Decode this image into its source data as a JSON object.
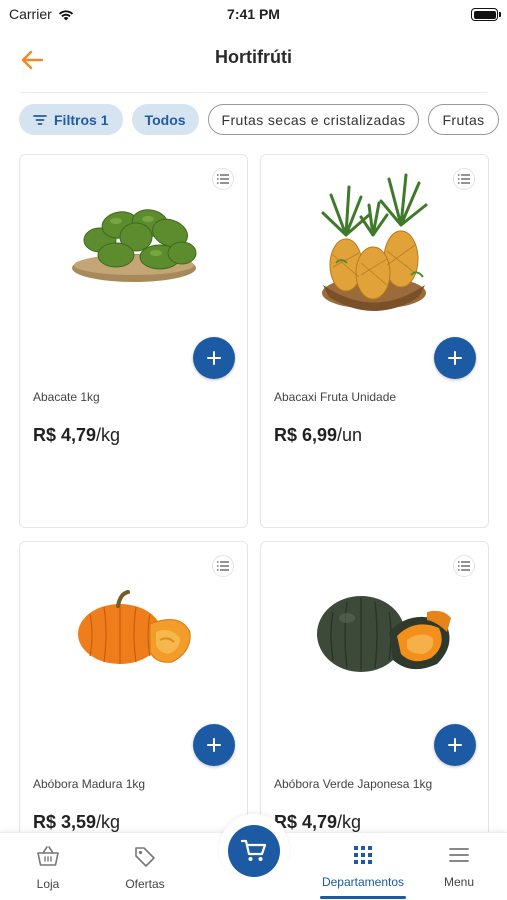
{
  "status": {
    "carrier": "Carrier",
    "time": "7:41 PM"
  },
  "header": {
    "title": "Hortifrúti"
  },
  "filters": {
    "filter_label": "Filtros",
    "filter_count": "1",
    "chips": [
      "Todos",
      "Frutas secas e cristalizadas",
      "Frutas"
    ]
  },
  "products": [
    {
      "name": "Abacate 1kg",
      "price": "R$ 4,79",
      "unit": "/kg",
      "image": "avocado-basket"
    },
    {
      "name": "Abacaxi Fruta Unidade",
      "price": "R$ 6,99",
      "unit": "/un",
      "image": "pineapple-basket"
    },
    {
      "name": "Abóbora Madura 1kg",
      "price": "R$ 3,59",
      "unit": "/kg",
      "image": "orange-pumpkin"
    },
    {
      "name": "Abóbora Verde Japonesa 1kg",
      "price": "R$ 4,79",
      "unit": "/kg",
      "image": "green-pumpkin"
    }
  ],
  "bottom_nav": {
    "items": [
      {
        "label": "Loja",
        "icon": "basket-icon"
      },
      {
        "label": "Ofertas",
        "icon": "tag-icon"
      },
      {
        "label": "Departamentos",
        "icon": "grid-icon",
        "active": true
      },
      {
        "label": "Menu",
        "icon": "hamburger-icon"
      }
    ],
    "cart_icon": "cart-icon"
  },
  "colors": {
    "accent": "#1c5aa3",
    "back_arrow": "#f08a24",
    "chip_bg": "#d6e4f2"
  }
}
